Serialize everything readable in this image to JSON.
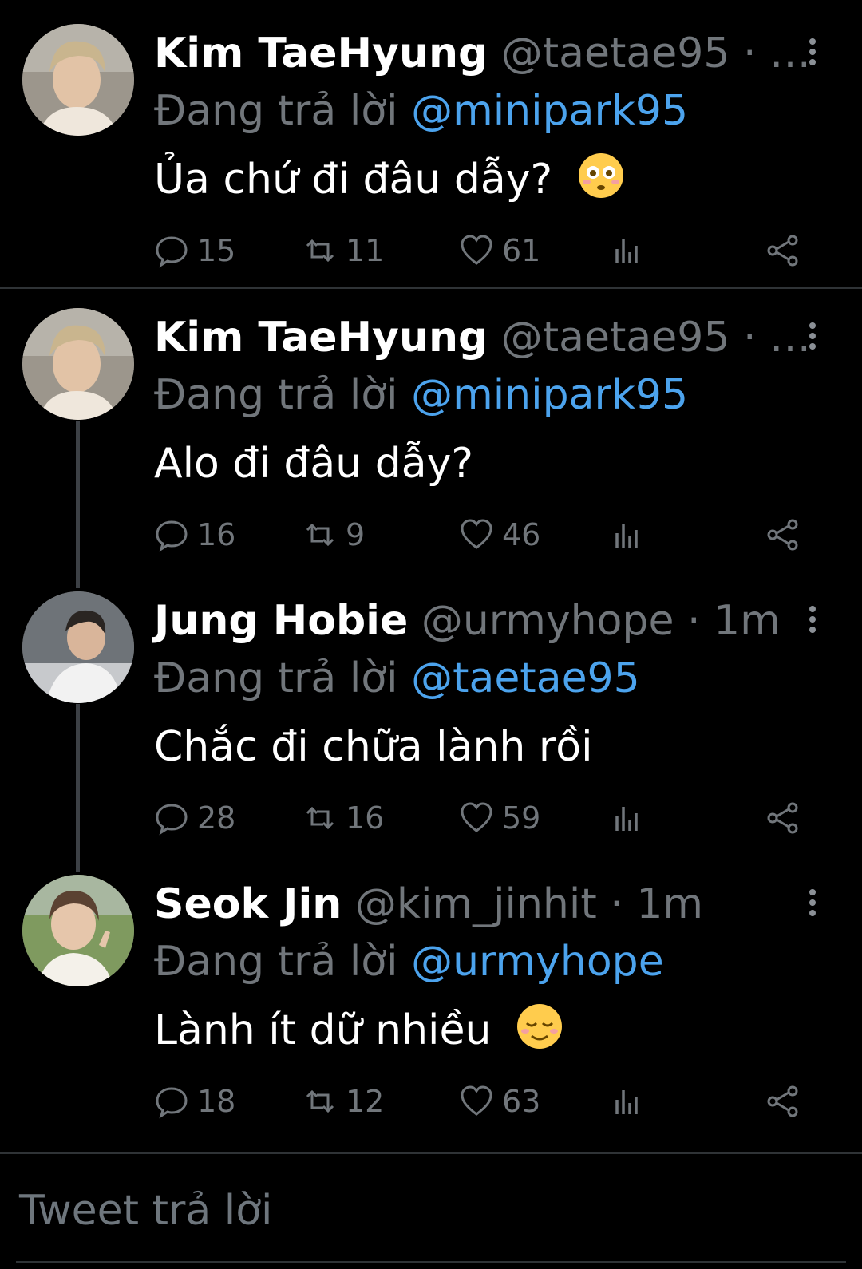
{
  "tweets": [
    {
      "name": "Kim TaeHyung",
      "handle": "@taetae95",
      "separator": "·",
      "time": "…",
      "reply_prefix": "Đang trả lời",
      "reply_to": "@minipark95",
      "text": "Ủa chứ đi đâu dẫy?",
      "emoji": "flushed-face-emoji",
      "replies": "15",
      "retweets": "11",
      "likes": "61"
    },
    {
      "name": "Kim TaeHyung",
      "handle": "@taetae95",
      "separator": "·",
      "time": "…",
      "reply_prefix": "Đang trả lời",
      "reply_to": "@minipark95",
      "text": "Alo đi đâu dẫy?",
      "replies": "16",
      "retweets": "9",
      "likes": "46"
    },
    {
      "name": "Jung Hobie",
      "handle": "@urmyhope",
      "separator": "·",
      "time": "1m",
      "reply_prefix": "Đang trả lời",
      "reply_to": "@taetae95",
      "text": "Chắc đi chữa lành rồi",
      "replies": "28",
      "retweets": "16",
      "likes": "59"
    },
    {
      "name": "Seok Jin",
      "handle": "@kim_jinhit",
      "separator": "·",
      "time": "1m",
      "reply_prefix": "Đang trả lời",
      "reply_to": "@urmyhope",
      "text": "Lành ít dữ nhiều",
      "emoji": "relieved-face-emoji",
      "replies": "18",
      "retweets": "12",
      "likes": "63"
    }
  ],
  "compose": {
    "placeholder": "Tweet trả lời"
  },
  "colors": {
    "background": "#000000",
    "link": "#4ca3ed",
    "muted": "#71767b",
    "divider": "#2f3336"
  }
}
